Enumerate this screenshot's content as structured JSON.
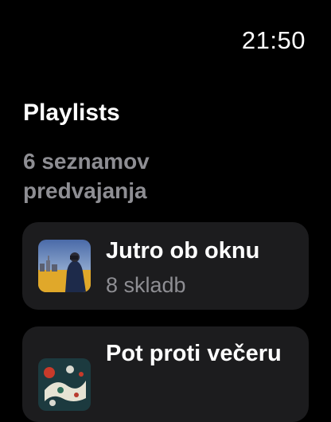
{
  "status": {
    "time": "21:50"
  },
  "header": {
    "title": "Playlists",
    "subtitle": "6 seznamov predvajanja"
  },
  "playlists": [
    {
      "title": "Jutro ob oknu",
      "subtitle": "8 skladb",
      "artwork_icon": "playlist-artwork-image"
    },
    {
      "title": "Pot proti večeru",
      "subtitle": "",
      "artwork_icon": "playlist-artwork-image"
    }
  ],
  "colors": {
    "background": "#000000",
    "card": "#1c1c1e",
    "secondary_text": "#8e8e93"
  }
}
